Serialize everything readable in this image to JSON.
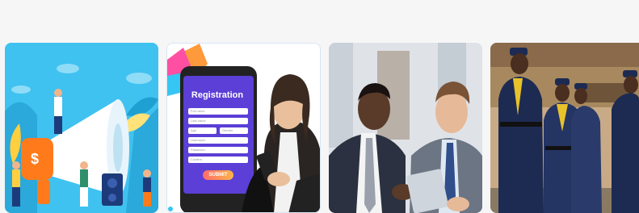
{
  "cards": [
    {
      "id": "marketing",
      "icon": "megaphone-illustration"
    },
    {
      "id": "registration",
      "icon": "registration-phone-illustration",
      "phone": {
        "title": "Registration",
        "fields": [
          "Full name",
          "Last name",
          "Age",
          "Gender",
          "Username",
          "Password",
          "Confirm"
        ],
        "submit": "SUBMIT"
      }
    },
    {
      "id": "business-meeting",
      "icon": "businessmen-photo"
    },
    {
      "id": "security-team",
      "icon": "security-guards-photo"
    }
  ],
  "colors": {
    "background": "#f6f6f7",
    "marketing_bg": "#3fc2f0",
    "megaphone_orange": "#ff7a1a",
    "phone_purple": "#5b3fd6",
    "uniform_navy": "#1d2b52"
  }
}
